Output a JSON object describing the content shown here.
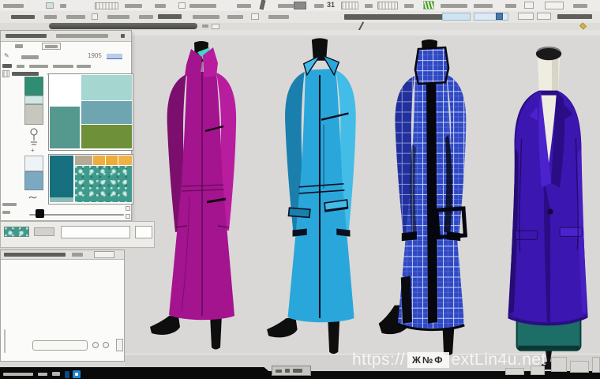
{
  "window": {
    "canvas_bg": "#d9d8d6",
    "chrome_bg": "#edecea",
    "panel_bg": "#fafaf8"
  },
  "toolbar": {
    "fragment_31": "31",
    "icons": [
      "new-document-icon",
      "swatch-icon",
      "grid-icon",
      "table-icon",
      "plant-logo-icon",
      "pen-cursor-icon",
      "dropdown-caret-icon",
      "window-controls"
    ]
  },
  "left_panel": {
    "meta_value": "1905",
    "strip_swatches": [
      "#2e8d72",
      "#cfe8e3",
      "#c7c7bf",
      "#eef3f7",
      "#7ba9c2"
    ],
    "palette_top": {
      "left_top": "#ffffff",
      "left_bottom": "#55988e",
      "right_rows": [
        "#a5d6d0",
        "#6fa5b0",
        "#6e9038"
      ]
    },
    "palette_bottom": {
      "left_column": "#17707f",
      "left_column_footer": "#8fbcb6",
      "top_row": [
        "#b5aa95",
        "#eeae3e",
        "#edac38",
        "#f0b246"
      ],
      "pattern_base": "#3e9a8d",
      "pattern_motif": "#d8ece4"
    }
  },
  "designs": [
    {
      "id": "magenta-coat",
      "main": "#a3148e",
      "dark": "#7c0f6d",
      "light": "#b81da0",
      "collar_accent": "#43d6c4",
      "trim": "#14030f"
    },
    {
      "id": "cyan-coat",
      "main": "#2aa7da",
      "dark": "#1b7fae",
      "light": "#43bce8",
      "trim": "#0b1020"
    },
    {
      "id": "check-coat",
      "main": "#2f49c4",
      "dark": "#22309e",
      "light": "#4560d8",
      "grid_line": "#dfe6ff",
      "trim": "#06060f"
    },
    {
      "id": "purple-coat",
      "main": "#3c16b0",
      "dark": "#2a0d84",
      "light": "#4c22cc",
      "form": "#efece1",
      "base": "#1d6e66",
      "trim": "#101014"
    }
  ],
  "watermark": {
    "prefix": "https://",
    "badge": "Ж№Ф",
    "suffix": "extLin4u.net"
  },
  "taskbar": {
    "accent": "#1f86cf"
  }
}
